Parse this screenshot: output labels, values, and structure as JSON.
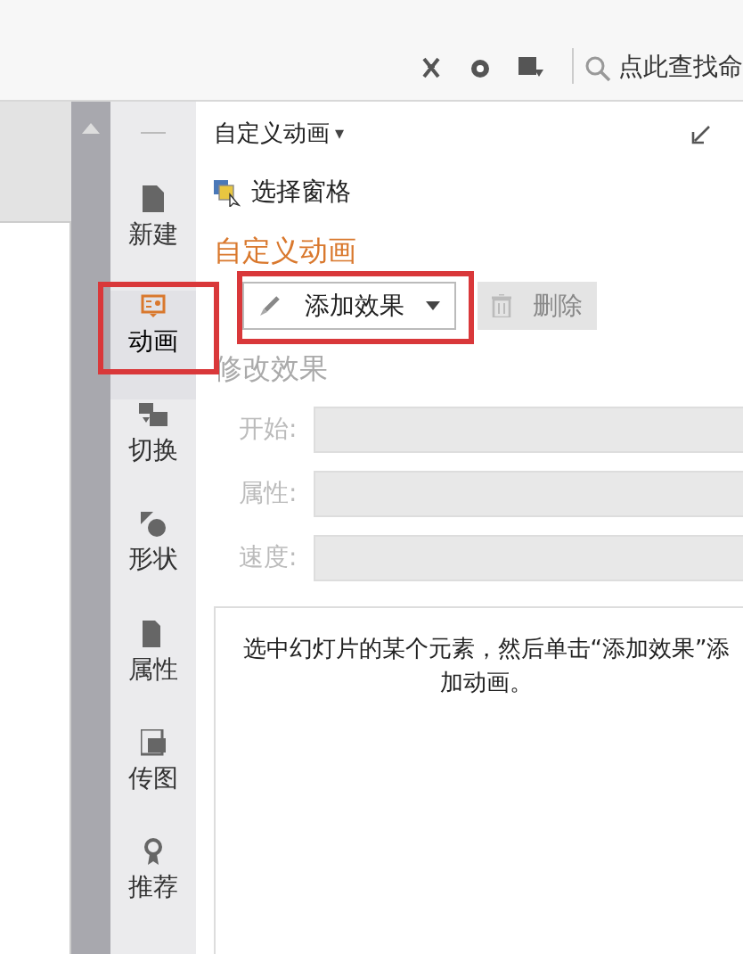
{
  "toolbar": {
    "search": {
      "placeholder": "点此查找命"
    }
  },
  "sidebar": {
    "items": [
      {
        "label": "新建",
        "selected": false,
        "highlighted": false
      },
      {
        "label": "动画",
        "selected": true,
        "highlighted": true
      },
      {
        "label": "切换",
        "selected": false,
        "highlighted": false
      },
      {
        "label": "形状",
        "selected": false,
        "highlighted": false
      },
      {
        "label": "属性",
        "selected": false,
        "highlighted": false
      },
      {
        "label": "传图",
        "selected": false,
        "highlighted": false
      },
      {
        "label": "推荐",
        "selected": false,
        "highlighted": false
      }
    ]
  },
  "panel": {
    "title": "自定义动画",
    "caret": "▾",
    "selection_pane": "选择窗格",
    "section_title": "自定义动画",
    "add_effect": {
      "label": "添加效果",
      "disabled": false,
      "highlighted": true
    },
    "delete": {
      "label": "删除",
      "disabled": true
    },
    "modify_title": "修改效果",
    "fields": [
      {
        "label": "开始:",
        "disabled": true
      },
      {
        "label": "属性:",
        "disabled": true
      },
      {
        "label": "速度:",
        "disabled": true
      }
    ],
    "hint": "选中幻灯片的某个元素，然后单击“添加效果”添加动画。"
  }
}
